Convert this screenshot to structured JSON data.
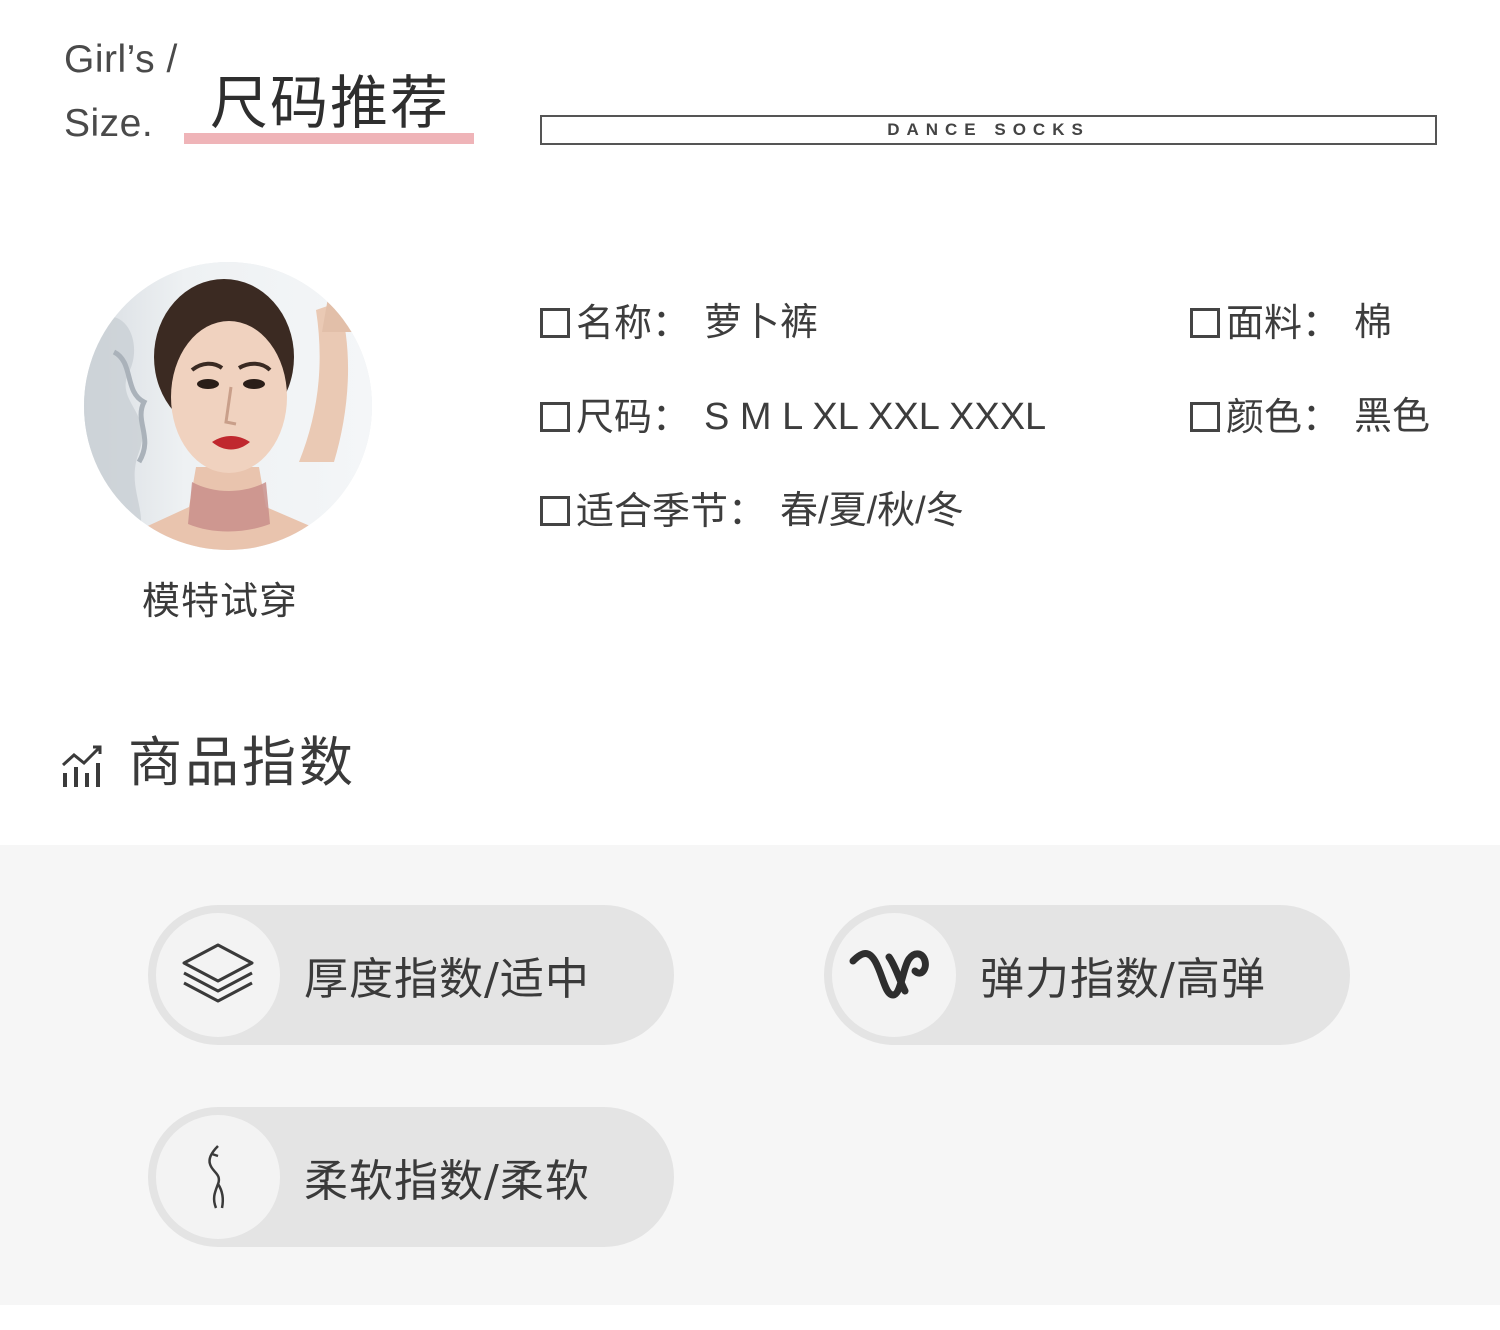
{
  "header": {
    "en_line1": "Girl’s /",
    "en_line2": "Size.",
    "title": "尺码推荐",
    "banner_text": "DANCE SOCKS",
    "accent_color": "#efb4b8"
  },
  "model": {
    "caption": "模特试穿"
  },
  "specs": [
    {
      "label": "名称：",
      "value": "萝卜裤"
    },
    {
      "label": "面料：",
      "value": "棉"
    },
    {
      "label": "尺码：",
      "value": "S M L XL XXL XXXL"
    },
    {
      "label": "颜色：",
      "value": "黑色"
    },
    {
      "label": "适合季节：",
      "value": "春/夏/秋/冬"
    }
  ],
  "index_section": {
    "title": "商品指数",
    "icon": "chart-bars-icon",
    "items": [
      {
        "icon": "layers-icon",
        "text": "厚度指数/适中"
      },
      {
        "icon": "wave-stretch-icon",
        "text": "弹力指数/高弹"
      },
      {
        "icon": "feather-soft-icon",
        "text": "柔软指数/柔软"
      }
    ]
  }
}
